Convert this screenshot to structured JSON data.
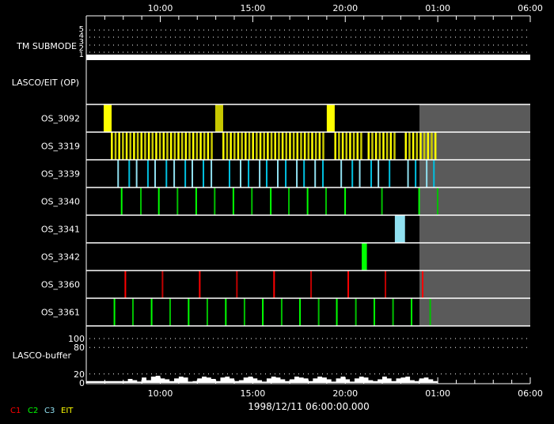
{
  "time_axis": {
    "span_hours": 24,
    "tick_labels": [
      {
        "hour": 4,
        "label": "10:00"
      },
      {
        "hour": 9,
        "label": "15:00"
      },
      {
        "hour": 14,
        "label": "20:00"
      },
      {
        "hour": 19,
        "label": "01:00"
      },
      {
        "hour": 24,
        "label": "06:00"
      }
    ],
    "date_label": "1998/12/11 06:00:00.000"
  },
  "tm_submode": {
    "label": "TM SUBMODE",
    "levels": [
      "5",
      "4",
      "3",
      "2",
      "1"
    ],
    "current_level": 1
  },
  "lasco_eit": {
    "label": "LASCO/EIT (OP)"
  },
  "future_shade_start_hour": 18.01,
  "colors": {
    "yellow": "#ffff00",
    "olive": "#c8c800",
    "lightcyan": "#90e0f0",
    "cyan": "#00c0e0",
    "green": "#00ff00",
    "darkgreen": "#00c000",
    "red": "#ff0000",
    "darkred": "#c00000",
    "shade": "#5a5a5a"
  },
  "rows": [
    {
      "label": "OS_3092",
      "events": [
        [
          0.94,
          0.43,
          "yellow"
        ],
        [
          6.97,
          0.43,
          "olive"
        ],
        [
          13.0,
          0.43,
          "yellow"
        ]
      ]
    },
    {
      "label": "OS_3319",
      "groups": [
        [
          1.33,
          6.85
        ],
        [
          7.36,
          12.88
        ],
        [
          13.41,
          14.89
        ],
        [
          15.21,
          16.69
        ],
        [
          17.22,
          18.92
        ]
      ],
      "period": 0.2,
      "colors": [
        "yellow",
        "olive"
      ]
    },
    {
      "label": "OS_3339",
      "ticks": [
        1.68,
        2.28,
        2.68,
        3.29,
        3.68,
        4.29,
        4.71,
        5.31,
        5.69,
        6.29,
        6.72,
        7.7,
        8.3,
        8.73,
        9.33,
        9.71,
        10.31,
        10.74,
        11.34,
        11.73,
        12.33,
        12.75,
        13.74,
        14.34,
        14.74,
        15.36,
        15.75,
        16.35,
        17.35,
        17.76,
        18.36,
        18.75
      ],
      "colors": [
        "lightcyan",
        "cyan"
      ]
    },
    {
      "label": "OS_3340",
      "ticks": [
        1.87,
        2.91,
        3.88,
        4.89,
        5.9,
        6.9,
        7.91,
        8.91,
        9.93,
        10.91,
        11.92,
        12.92,
        13.95,
        15.94,
        17.95,
        18.95
      ],
      "colors": [
        "green",
        "darkgreen"
      ]
    },
    {
      "label": "OS_3341",
      "events": [
        [
          16.68,
          0.55,
          "lightcyan"
        ]
      ]
    },
    {
      "label": "OS_3342",
      "events": [
        [
          14.89,
          0.28,
          "green"
        ]
      ]
    },
    {
      "label": "OS_3360",
      "ticks": [
        2.07,
        4.08,
        6.09,
        8.1,
        10.11,
        12.11,
        14.12,
        16.13,
        18.14
      ],
      "colors": [
        "red",
        "darkred"
      ]
    },
    {
      "label": "OS_3361",
      "ticks": [
        1.48,
        2.48,
        3.49,
        4.49,
        5.49,
        6.5,
        7.5,
        8.51,
        9.5,
        10.52,
        11.51,
        12.52,
        13.5,
        14.53,
        15.53,
        16.54,
        17.54,
        18.55
      ],
      "colors": [
        "green",
        "darkgreen"
      ]
    }
  ],
  "buffer": {
    "label": "LASCO-buffer",
    "y_ticks": [
      "100",
      "80",
      "20",
      "0"
    ],
    "step_hours": 0.25,
    "values": [
      4,
      4,
      4,
      4,
      4,
      4,
      4,
      4,
      4,
      9,
      6,
      3,
      12,
      6,
      14,
      16,
      10,
      8,
      4,
      10,
      14,
      12,
      3,
      4,
      10,
      14,
      12,
      9,
      4,
      12,
      14,
      10,
      4,
      6,
      12,
      14,
      10,
      6,
      3,
      10,
      14,
      12,
      8,
      4,
      8,
      14,
      12,
      10,
      4,
      10,
      14,
      12,
      8,
      3,
      10,
      14,
      8,
      3,
      10,
      14,
      12,
      6,
      4,
      8,
      14,
      10,
      4,
      10,
      12,
      14,
      6,
      4,
      10,
      12,
      8,
      4
    ]
  },
  "legend": [
    {
      "label": "C1",
      "color": "#ff0000"
    },
    {
      "label": "C2",
      "color": "#00ff00"
    },
    {
      "label": "C3",
      "color": "#90e0f0"
    },
    {
      "label": "EIT",
      "color": "#ffff00"
    }
  ]
}
